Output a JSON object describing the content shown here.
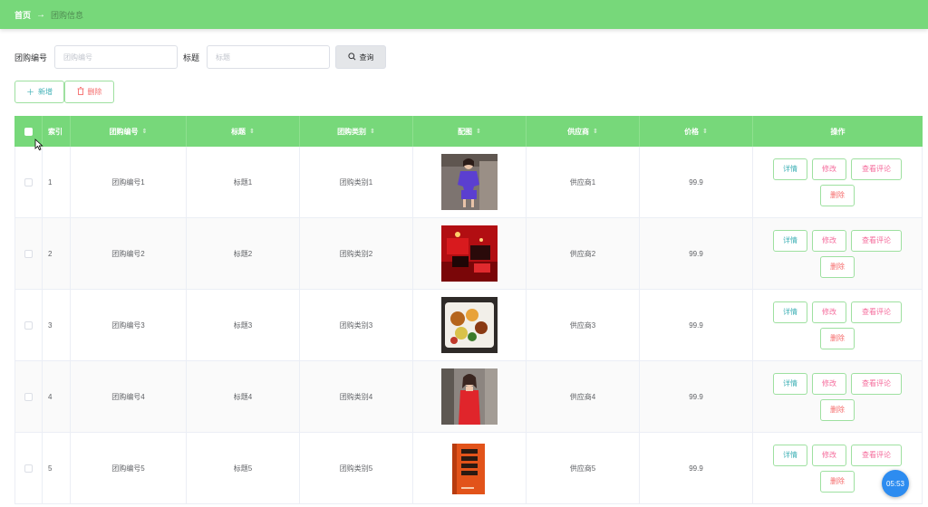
{
  "breadcrumb": {
    "home": "首页",
    "separator": "→",
    "current": "团购信息"
  },
  "search": {
    "code_label": "团购编号",
    "code_placeholder": "团购编号",
    "title_label": "标题",
    "title_placeholder": "标题",
    "query_label": "查询",
    "query_icon": "search-icon"
  },
  "toolbar": {
    "add_label": "新增",
    "add_icon": "plus-icon",
    "delete_label": "删除",
    "delete_icon": "trash-icon"
  },
  "table": {
    "headers": [
      "",
      "索引",
      "团购编号",
      "标题",
      "团购类别",
      "配图",
      "供应商",
      "价格",
      "操作"
    ],
    "rows": [
      {
        "index": "1",
        "code": "团购编号1",
        "title": "标题1",
        "category": "团购类别1",
        "image": "woman-purple-outfit",
        "supplier": "供应商1",
        "price": "99.9"
      },
      {
        "index": "2",
        "code": "团购编号2",
        "title": "标题2",
        "category": "团购类别2",
        "image": "red-gift-boxes",
        "supplier": "供应商2",
        "price": "99.9"
      },
      {
        "index": "3",
        "code": "团购编号3",
        "title": "标题3",
        "category": "团购类别3",
        "image": "food-dish",
        "supplier": "供应商3",
        "price": "99.9"
      },
      {
        "index": "4",
        "code": "团购编号4",
        "title": "标题4",
        "category": "团购类别4",
        "image": "woman-red-dress",
        "supplier": "供应商4",
        "price": "99.9"
      },
      {
        "index": "5",
        "code": "团购编号5",
        "title": "标题5",
        "category": "团购类别5",
        "image": "orange-book",
        "supplier": "供应商5",
        "price": "99.9"
      }
    ],
    "ops": {
      "detail": "详情",
      "edit": "修改",
      "review": "查看评论",
      "remove": "删除"
    }
  },
  "clock": "05:53",
  "colors": {
    "header_green": "#77d87a",
    "detail_text": "#3fb0b6",
    "edit_text": "#f56c9c",
    "remove_text": "#f56c6c",
    "clock_blue": "#2d8cf0"
  }
}
